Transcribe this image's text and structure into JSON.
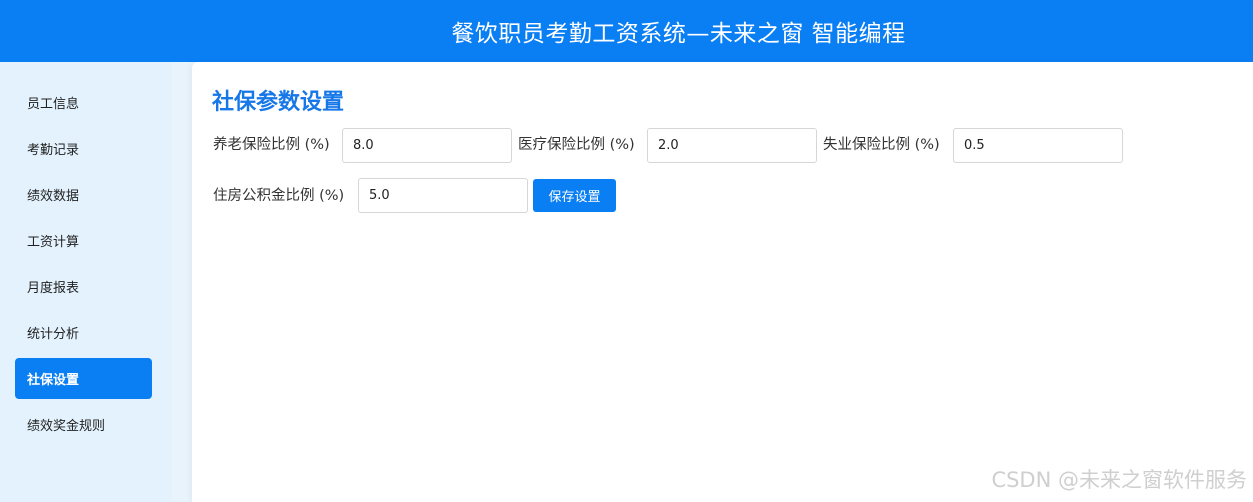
{
  "header": {
    "title": "餐饮职员考勤工资系统—未来之窗 智能编程"
  },
  "sidebar": {
    "items": [
      {
        "label": "员工信息"
      },
      {
        "label": "考勤记录"
      },
      {
        "label": "绩效数据"
      },
      {
        "label": "工资计算"
      },
      {
        "label": "月度报表"
      },
      {
        "label": "统计分析"
      },
      {
        "label": "社保设置"
      },
      {
        "label": "绩效奖金规则"
      }
    ],
    "active_label": "社保设置"
  },
  "main": {
    "title": "社保参数设置",
    "fields": [
      {
        "label": "养老保险比例 (%)",
        "value": "8.0"
      },
      {
        "label": "医疗保险比例 (%)",
        "value": "2.0"
      },
      {
        "label": "失业保险比例 (%)",
        "value": "0.5"
      },
      {
        "label": "住房公积金比例 (%)",
        "value": "5.0"
      }
    ],
    "save_label": "保存设置"
  },
  "watermark": "CSDN @未来之窗软件服务",
  "colors": {
    "accent": "#0a7ef3",
    "sidebar_bg": "#e3f2fd",
    "title_color": "#1677e8"
  }
}
